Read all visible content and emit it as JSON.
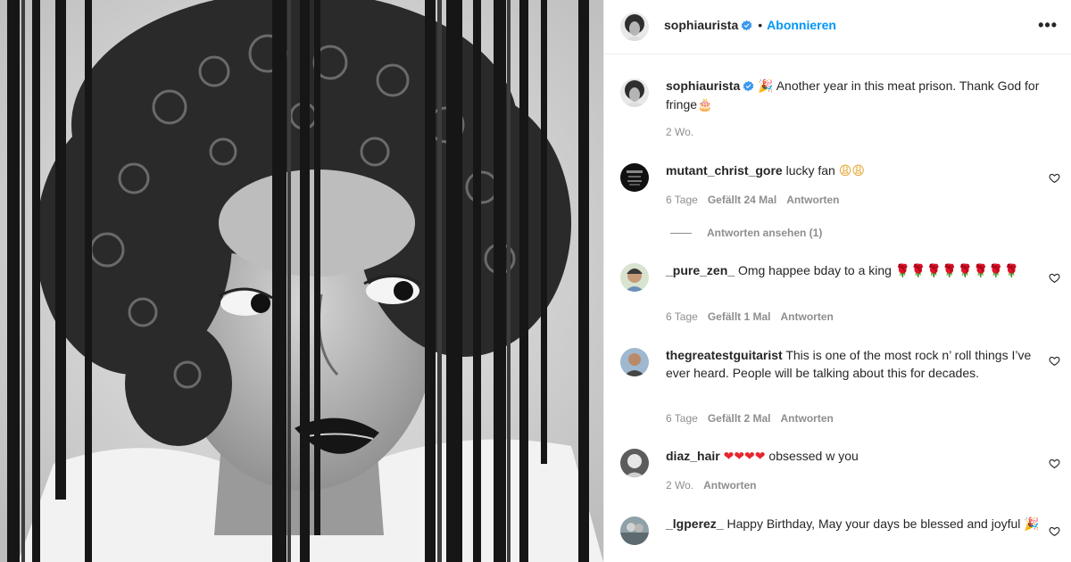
{
  "header": {
    "username": "sophiaurista",
    "dot": "•",
    "follow_label": "Abonnieren",
    "more_label": "•••"
  },
  "caption": {
    "username": "sophiaurista",
    "party_emoji": "🎉",
    "text": "Another year in this meat prison. Thank God for fringe",
    "cake_emoji": "🎂",
    "time": "2 Wo."
  },
  "comments": [
    {
      "username": "mutant_christ_gore",
      "text": "lucky fan",
      "emoji": "😩😩",
      "time": "6 Tage",
      "likes": "Gefällt 24 Mal",
      "reply_label": "Antworten",
      "view_replies": "Antworten ansehen (1)"
    },
    {
      "username": "_pure_zen_",
      "text": "Omg happee bday to a king",
      "emoji": "🌹🌹🌹🌹🌹🌹🌹🌹",
      "time": "6 Tage",
      "likes": "Gefällt 1 Mal",
      "reply_label": "Antworten"
    },
    {
      "username": "thegreatestguitarist",
      "text": "This is one of the most rock n’ roll things I’ve ever heard. People will be talking about this for decades.",
      "time": "6 Tage",
      "likes": "Gefällt 2 Mal",
      "reply_label": "Antworten"
    },
    {
      "username": "diaz_hair",
      "emoji": "❤❤❤❤",
      "text": "obsessed w you",
      "time": "2 Wo.",
      "reply_label": "Antworten"
    },
    {
      "username": "_lgperez_",
      "text": "Happy Birthday, May your days be blessed and joyful",
      "emoji": "🎉"
    }
  ],
  "colors": {
    "accent": "#0095f6",
    "text": "#262626",
    "muted": "#8e8e8e",
    "divider": "#efefef"
  },
  "icons": [
    "verified-badge-icon",
    "heart-icon",
    "more-options-icon"
  ]
}
